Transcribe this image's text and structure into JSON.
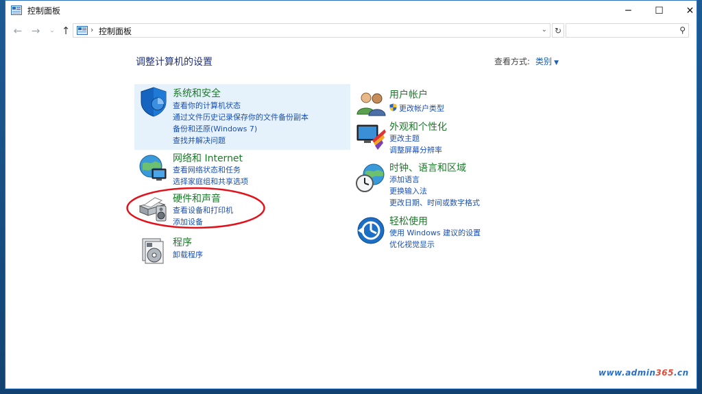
{
  "window": {
    "title": "控制面板",
    "minimize": "─",
    "maximize": "☐",
    "close": "✕"
  },
  "nav": {
    "back": "←",
    "forward": "→",
    "dropdown": "⌄",
    "up": "↑",
    "address_separator": "›",
    "address_text": "控制面板",
    "address_chevron": "⌄",
    "refresh": "↻",
    "search_placeholder": "",
    "search_icon": "⚲"
  },
  "content": {
    "heading": "调整计算机的设置",
    "view_by_label": "查看方式:",
    "view_by_value": "类别",
    "view_by_caret": "▼"
  },
  "categories_left": [
    {
      "icon": "security-shield-icon",
      "title": "系统和安全",
      "links": [
        "查看你的计算机状态",
        "通过文件历史记录保存你的文件备份副本",
        "备份和还原(Windows 7)",
        "查找并解决问题"
      ]
    },
    {
      "icon": "network-globe-icon",
      "title": "网络和 Internet",
      "links": [
        "查看网络状态和任务",
        "选择家庭组和共享选项"
      ]
    },
    {
      "icon": "printer-speaker-icon",
      "title": "硬件和声音",
      "links": [
        "查看设备和打印机",
        "添加设备"
      ]
    },
    {
      "icon": "programs-disc-icon",
      "title": "程序",
      "links": [
        "卸载程序"
      ]
    }
  ],
  "categories_right": [
    {
      "icon": "users-icon",
      "title": "用户帐户",
      "links": [
        "更改帐户类型"
      ]
    },
    {
      "icon": "display-palette-icon",
      "title": "外观和个性化",
      "links": [
        "更改主题",
        "调整屏幕分辨率"
      ]
    },
    {
      "icon": "clock-globe-icon",
      "title": "时钟、语言和区域",
      "links": [
        "添加语言",
        "更换输入法",
        "更改日期、时间或数字格式"
      ]
    },
    {
      "icon": "ease-of-access-icon",
      "title": "轻松使用",
      "links": [
        "使用 Windows 建议的设置",
        "优化视觉显示"
      ]
    }
  ],
  "watermark": {
    "prefix": "www.",
    "brand": "admin",
    "number": "365",
    "suffix": ".cn"
  },
  "colors": {
    "category_title": "#1a7a28",
    "link": "#1a4fb4",
    "highlight_bg": "#e5f1fb",
    "annotation": "#e0121b"
  }
}
